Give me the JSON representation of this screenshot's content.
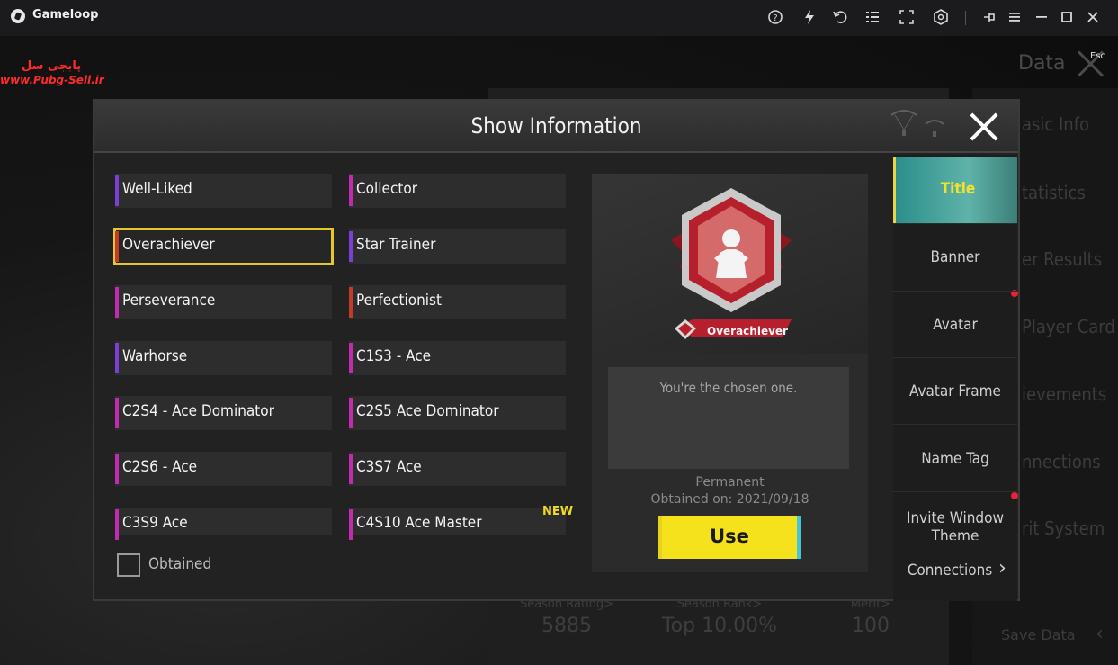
{
  "emulator": {
    "app_name": "Gameloop",
    "toolbar_icons": [
      "help-icon",
      "boost-icon",
      "undo-icon",
      "keyboard-layout-icon",
      "fullscreen-icon",
      "settings-cube-icon",
      "pin-icon",
      "menu-icon",
      "minimize-icon",
      "maximize-icon",
      "close-icon"
    ]
  },
  "watermark": {
    "fa_text": "پابجی سل",
    "url": "www.Pubg-Sell.ir"
  },
  "background": {
    "data_title": "Data",
    "esc_label": "Esc",
    "sidebar_items": [
      "asic Info",
      "tatistics",
      "er Results",
      "Player Card",
      "ievements",
      "nnections",
      "rit System"
    ],
    "stats": [
      {
        "label": "Season Rating>",
        "value": "5885"
      },
      {
        "label": "Season Rank>",
        "value": "Top 10.00%"
      },
      {
        "label": "Merit>",
        "value": "100"
      }
    ],
    "save_data": "Save Data"
  },
  "modal": {
    "title": "Show Information",
    "titles": [
      {
        "label": "Well-Liked",
        "color": "#7b3fd6"
      },
      {
        "label": "Collector",
        "color": "#c02bb0"
      },
      {
        "label": "Overachiever",
        "color": "#c23a2a",
        "selected": true
      },
      {
        "label": "Star Trainer",
        "color": "#7b3fd6"
      },
      {
        "label": "Perseverance",
        "color": "#c02bb0"
      },
      {
        "label": "Perfectionist",
        "color": "#c23a2a"
      },
      {
        "label": "Warhorse",
        "color": "#7b3fd6"
      },
      {
        "label": "C1S3 - Ace",
        "color": "#c02bb0"
      },
      {
        "label": "C2S4 - Ace Dominator",
        "color": "#c02bb0"
      },
      {
        "label": "C2S5 Ace Dominator",
        "color": "#c02bb0"
      },
      {
        "label": "C2S6 - Ace",
        "color": "#c02bb0"
      },
      {
        "label": "C3S7 Ace",
        "color": "#c02bb0"
      },
      {
        "label": "C3S9 Ace",
        "color": "#c02bb0"
      },
      {
        "label": "C4S10 Ace Master",
        "color": "#c02bb0"
      }
    ],
    "new_badge": "NEW",
    "obtained_filter": {
      "label": "Obtained",
      "checked": false
    },
    "preview": {
      "emblem_label": "Overachiever",
      "description": "You're the chosen one.",
      "duration": "Permanent",
      "obtained_on": "Obtained on: 2021/09/18",
      "use_label": "Use"
    },
    "tabs": [
      "Title",
      "Banner",
      "Avatar",
      "Avatar Frame",
      "Name Tag",
      "Invite Window Theme",
      "Connections"
    ],
    "active_tab": "Title",
    "colors": {
      "accent_yellow": "#f6e21c",
      "active_tab_teal": "#5fb3a9",
      "notification_red": "#e8223a"
    }
  }
}
